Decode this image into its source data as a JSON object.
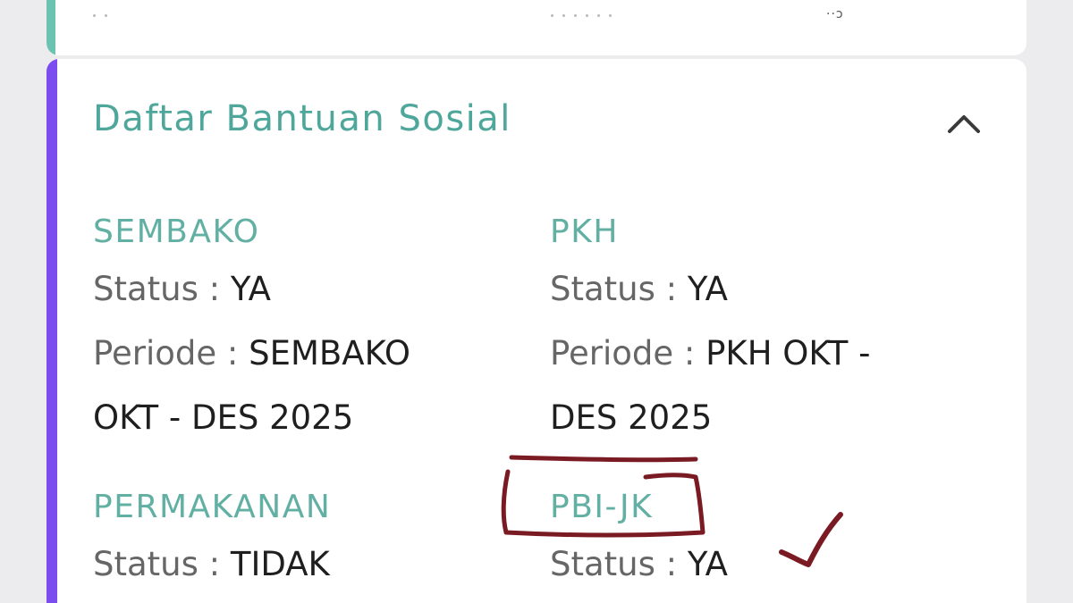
{
  "section": {
    "title": "Daftar Bantuan Sosial",
    "collapse_icon": "chevron-up-icon"
  },
  "programs": [
    {
      "name": "SEMBAKO",
      "status_label": "Status : ",
      "status_value": "YA",
      "period_label": "Periode : ",
      "period_value_line1": "SEMBAKO",
      "period_value_line2": "OKT - DES 2025"
    },
    {
      "name": "PKH",
      "status_label": "Status : ",
      "status_value": "YA",
      "period_label": "Periode : ",
      "period_value_line1": "PKH OKT -",
      "period_value_line2": "DES 2025"
    },
    {
      "name": "PERMAKANAN",
      "status_label": "Status : ",
      "status_value": "TIDAK"
    },
    {
      "name": "PBI-JK",
      "status_label": "Status : ",
      "status_value": "YA"
    }
  ],
  "colors": {
    "accent_purple": "#7b4cf0",
    "accent_teal": "#6cc3b2",
    "heading_teal": "#4ea79a",
    "annotation_red": "#7a1a22"
  }
}
